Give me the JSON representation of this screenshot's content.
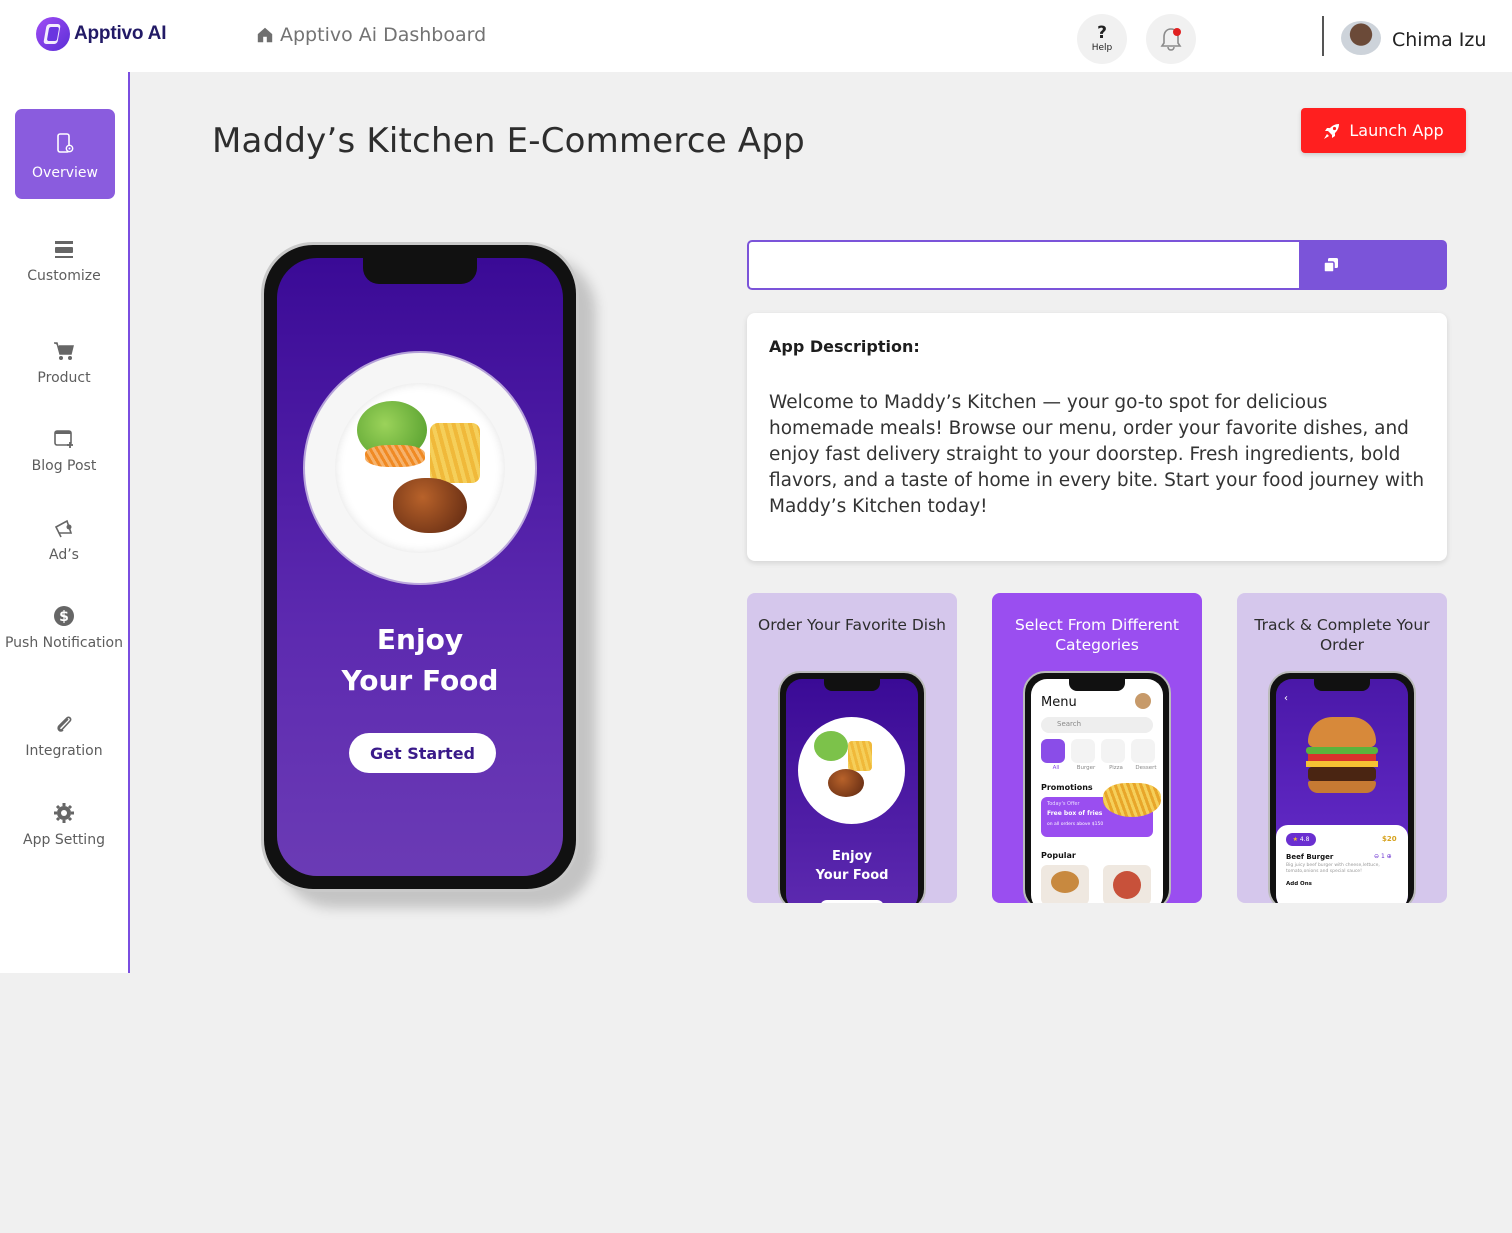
{
  "app": {
    "logo_text": "Apptivo AI"
  },
  "header": {
    "breadcrumb": "Apptivo Ai Dashboard",
    "help_label": "Help",
    "help_glyph": "?",
    "user_name": "Chima Izu"
  },
  "sidebar": {
    "items": [
      {
        "label": "Overview",
        "icon": "phone-gear-icon",
        "active": true
      },
      {
        "label": "Customize",
        "icon": "layout-icon"
      },
      {
        "label": "Product",
        "icon": "cart-icon"
      },
      {
        "label": "Blog Post",
        "icon": "add-window-icon"
      },
      {
        "label": "Ad’s",
        "icon": "megaphone-icon"
      },
      {
        "label": "Push Notification",
        "icon": "dollar-icon"
      },
      {
        "label": "Integration",
        "icon": "paperclip-icon"
      },
      {
        "label": "App Setting",
        "icon": "gear-icon"
      }
    ]
  },
  "main": {
    "title": "Maddy’s Kitchen E-Commerce App",
    "launch_label": "Launch App",
    "url_value": "",
    "description_heading": "App Description:",
    "description_body": "Welcome to Maddy’s Kitchen — your go-to spot for delicious homemade meals! Browse our menu, order your favorite dishes, and enjoy fast delivery straight to your doorstep. Fresh ingredients, bold flavors, and a taste of home in every bite. Start your food journey with Maddy’s Kitchen today!"
  },
  "preview": {
    "line1": "Enjoy",
    "line2": "Your Food",
    "cta": "Get Started"
  },
  "screenshots": [
    {
      "title": "Order Your Favorite Dish",
      "mini_line1": "Enjoy",
      "mini_line2": "Your Food"
    },
    {
      "title": "Select From Different Categories",
      "menu_title": "Menu",
      "search_placeholder": "Search",
      "categories": [
        "All",
        "Burger",
        "Pizza",
        "Dessert"
      ],
      "promotions_label": "Promotions",
      "promo_tag": "Today's Offer",
      "promo_title": "Free box of fries",
      "promo_sub": "on all orders above $150",
      "popular_label": "Popular"
    },
    {
      "title": "Track & Complete Your Order",
      "rating": "4.8",
      "price": "$20",
      "item_name": "Beef Burger",
      "qty": "1",
      "item_desc": "Big juicy beef burger with cheese,lettuce, tomato,onions and special sauce!",
      "addons_label": "Add Ons"
    }
  ],
  "colors": {
    "accent": "#7b54d9",
    "sidebar_active": "#8a5cde",
    "launch": "#ff1f1f",
    "card_light": "#d9c9ee",
    "card_bright": "#9a4ef0"
  }
}
